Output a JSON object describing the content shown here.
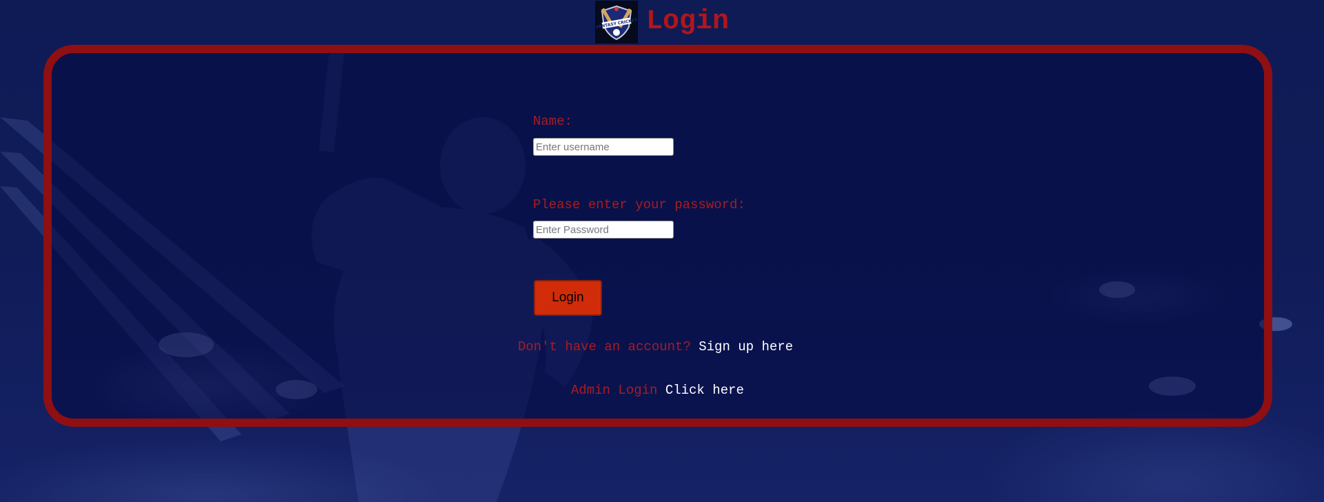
{
  "header": {
    "logo_text": "FANTASY CRICKET",
    "title": "Login"
  },
  "form": {
    "name_label": "Name:",
    "name_placeholder": "Enter username",
    "password_label": "Please enter your password:",
    "password_placeholder": "Enter Password",
    "login_button": "Login"
  },
  "signup": {
    "prompt": "Don't have an account?",
    "link": "Sign up here"
  },
  "admin": {
    "prompt": "Admin Login",
    "link": "Click here"
  },
  "colors": {
    "accent_red": "#a81c22",
    "panel_border": "#8f0f12",
    "button": "#d12c0a",
    "background": "#0d1850"
  }
}
